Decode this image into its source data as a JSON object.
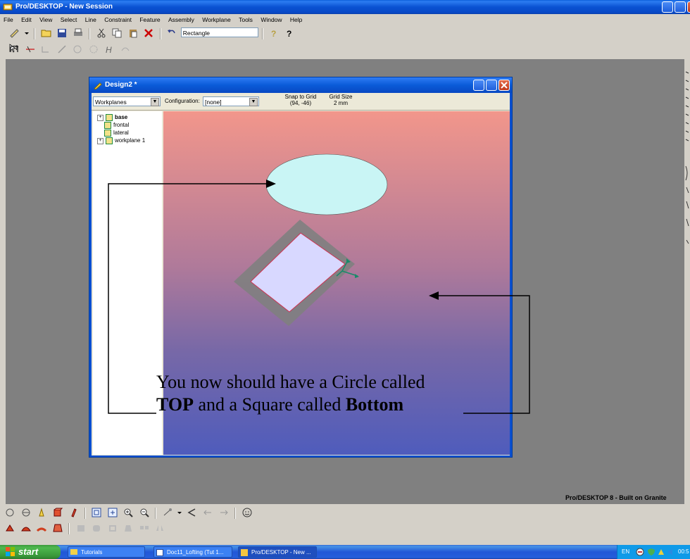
{
  "app": {
    "title": "Pro/DESKTOP - New Session",
    "branding": "Pro/DESKTOP 8 - Built on Granite"
  },
  "menu": [
    "File",
    "Edit",
    "View",
    "Select",
    "Line",
    "Constraint",
    "Feature",
    "Assembly",
    "Workplane",
    "Tools",
    "Window",
    "Help"
  ],
  "toolbar": {
    "command_combo": "Rectangle"
  },
  "design_window": {
    "title": "Design2 *",
    "browser_combo": "Workplanes",
    "configuration_label": "Configuration:",
    "configuration_value": "[none]",
    "snap_label": "Snap to Grid",
    "snap_value": "(94, -46)",
    "grid_label": "Grid Size",
    "grid_value": "2 mm",
    "tree": [
      {
        "label": "base",
        "expandable": true,
        "bold": true
      },
      {
        "label": "frontal",
        "expandable": false,
        "bold": false
      },
      {
        "label": "lateral",
        "expandable": false,
        "bold": false
      },
      {
        "label": "workplane 1",
        "expandable": true,
        "bold": false
      }
    ]
  },
  "annotation": {
    "line1": "You now should have a Circle called",
    "line2_bold1": "TOP",
    "line2_mid": " and a Square called ",
    "line2_bold2": "Bottom"
  },
  "taskbar": {
    "start": "start",
    "tasks": [
      "Tutorials",
      "Doc11_Lofting (Tut 1...",
      "Pro/DESKTOP - New ..."
    ],
    "lang": "EN",
    "clock": "00:5"
  },
  "colors": {
    "ellipse_fill": "#c9f5f5",
    "square_fill": "#d8d8ff",
    "square_frame": "#808080",
    "square_edge": "#d03050",
    "axis": "#1a8a6a"
  }
}
